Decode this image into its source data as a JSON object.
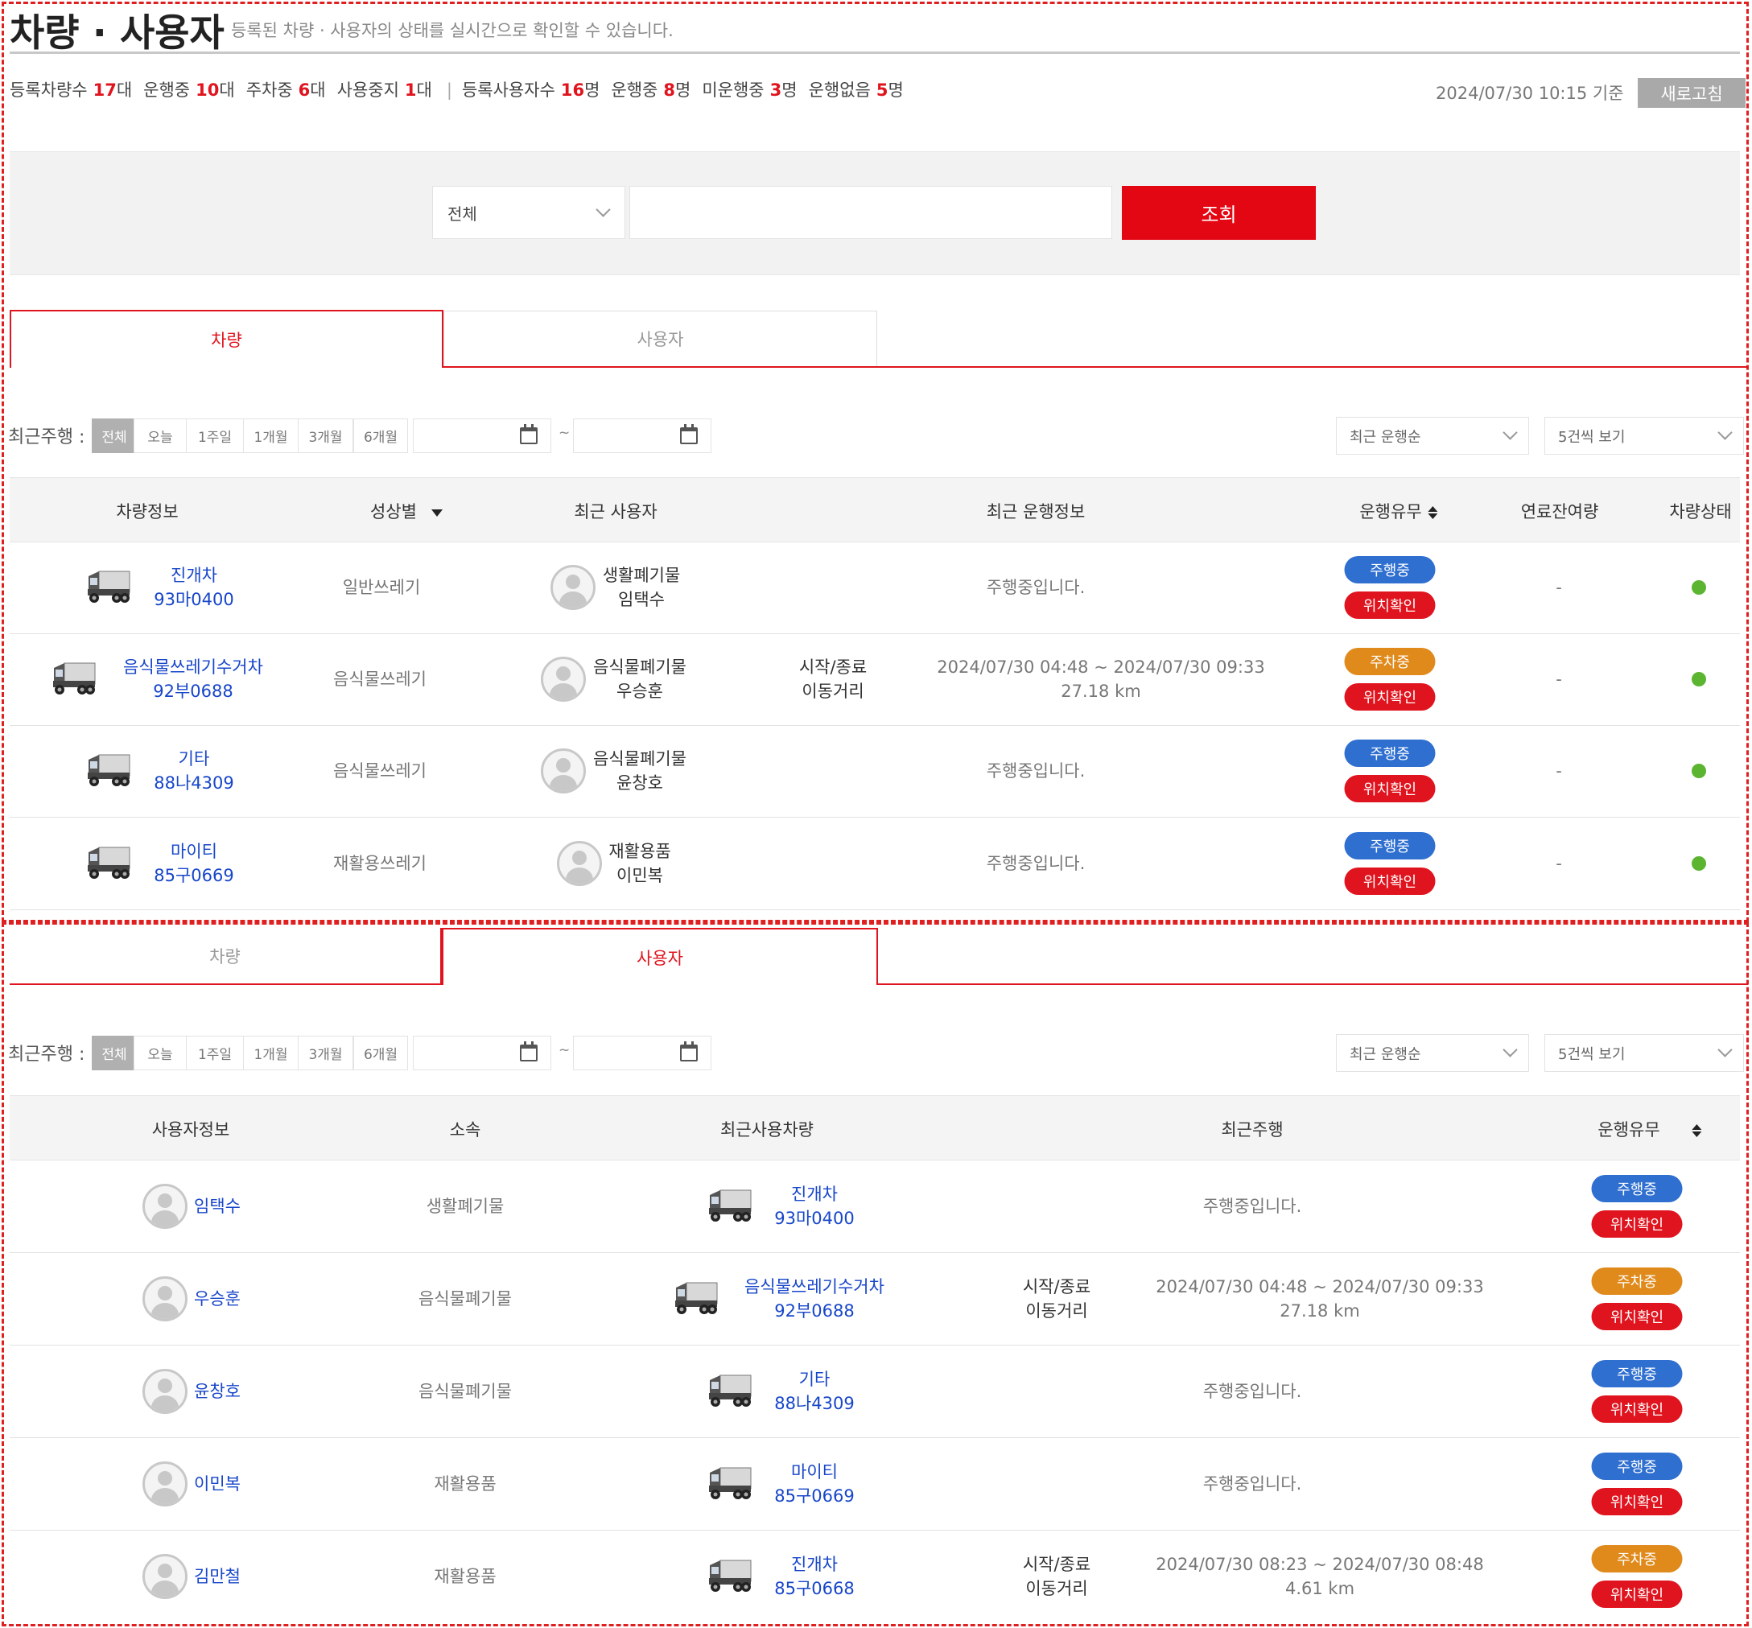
{
  "header": {
    "title": "차량 · 사용자",
    "description": "등록된 차량 · 사용자의 상태를 실시간으로 확인할 수 있습니다.",
    "as_of": "2024/07/30  10:15  기준",
    "refresh_label": "새로고침"
  },
  "stats": [
    {
      "label": "등록차량수",
      "value": "17",
      "unit": "대"
    },
    {
      "label": "운행중",
      "value": "10",
      "unit": "대"
    },
    {
      "label": "주차중",
      "value": "6",
      "unit": "대"
    },
    {
      "label": "사용중지",
      "value": "1",
      "unit": "대"
    },
    {
      "label": "등록사용자수",
      "value": "16",
      "unit": "명"
    },
    {
      "label": "운행중",
      "value": "8",
      "unit": "명"
    },
    {
      "label": "미운행중",
      "value": "3",
      "unit": "명"
    },
    {
      "label": "운행없음",
      "value": "5",
      "unit": "명"
    }
  ],
  "search": {
    "select_value": "전체",
    "input_value": "",
    "button_label": "조회"
  },
  "tabs": {
    "vehicle": "차량",
    "user": "사용자"
  },
  "filter": {
    "label": "최근주행 :",
    "chips": [
      "전체",
      "오늘",
      "1주일",
      "1개월",
      "3개월",
      "6개월"
    ],
    "active_chip": "전체",
    "tilde": "~",
    "sort_select": "최근 운행순",
    "page_size_select": "5건씩 보기"
  },
  "vehicle_table": {
    "headers": [
      "차량정보",
      "성상별",
      "최근 사용자",
      "최근 운행정보",
      "운행유무",
      "연료잔여량",
      "차량상태"
    ],
    "rows": [
      {
        "name": "진개차",
        "plate": "93마0400",
        "waste": "일반쓰레기",
        "user_org": "생활폐기물",
        "user_name": "임택수",
        "trip_label1": "",
        "trip_label2": "",
        "trip_line1": "주행중입니다.",
        "trip_line2": "",
        "status": "주행중",
        "status_type": "drive",
        "locate": "위치확인",
        "fuel": "-"
      },
      {
        "name": "음식물쓰레기수거차",
        "plate": "92부0688",
        "waste": "음식물쓰레기",
        "user_org": "음식물폐기물",
        "user_name": "우승훈",
        "trip_label1": "시작/종료",
        "trip_label2": "이동거리",
        "trip_line1": "2024/07/30 04:48 ~ 2024/07/30 09:33",
        "trip_line2": "27.18 km",
        "status": "주차중",
        "status_type": "park",
        "locate": "위치확인",
        "fuel": "-"
      },
      {
        "name": "기타",
        "plate": "88나4309",
        "waste": "음식물쓰레기",
        "user_org": "음식물폐기물",
        "user_name": "윤창호",
        "trip_label1": "",
        "trip_label2": "",
        "trip_line1": "주행중입니다.",
        "trip_line2": "",
        "status": "주행중",
        "status_type": "drive",
        "locate": "위치확인",
        "fuel": "-"
      },
      {
        "name": "마이티",
        "plate": "85구0669",
        "waste": "재활용쓰레기",
        "user_org": "재활용품",
        "user_name": "이민복",
        "trip_label1": "",
        "trip_label2": "",
        "trip_line1": "주행중입니다.",
        "trip_line2": "",
        "status": "주행중",
        "status_type": "drive",
        "locate": "위치확인",
        "fuel": "-"
      }
    ]
  },
  "user_table": {
    "headers": [
      "사용자정보",
      "소속",
      "최근사용차량",
      "최근주행",
      "운행유무"
    ],
    "rows": [
      {
        "name": "임택수",
        "org": "생활폐기물",
        "vehicle": "진개차",
        "plate": "93마0400",
        "trip_label1": "",
        "trip_label2": "",
        "trip_line1": "주행중입니다.",
        "trip_line2": "",
        "status": "주행중",
        "status_type": "drive",
        "locate": "위치확인"
      },
      {
        "name": "우승훈",
        "org": "음식물폐기물",
        "vehicle": "음식물쓰레기수거차",
        "plate": "92부0688",
        "trip_label1": "시작/종료",
        "trip_label2": "이동거리",
        "trip_line1": "2024/07/30 04:48 ~ 2024/07/30 09:33",
        "trip_line2": "27.18 km",
        "status": "주차중",
        "status_type": "park",
        "locate": "위치확인"
      },
      {
        "name": "윤창호",
        "org": "음식물폐기물",
        "vehicle": "기타",
        "plate": "88나4309",
        "trip_label1": "",
        "trip_label2": "",
        "trip_line1": "주행중입니다.",
        "trip_line2": "",
        "status": "주행중",
        "status_type": "drive",
        "locate": "위치확인"
      },
      {
        "name": "이민복",
        "org": "재활용품",
        "vehicle": "마이티",
        "plate": "85구0669",
        "trip_label1": "",
        "trip_label2": "",
        "trip_line1": "주행중입니다.",
        "trip_line2": "",
        "status": "주행중",
        "status_type": "drive",
        "locate": "위치확인"
      },
      {
        "name": "김만철",
        "org": "재활용품",
        "vehicle": "진개차",
        "plate": "85구0668",
        "trip_label1": "시작/종료",
        "trip_label2": "이동거리",
        "trip_line1": "2024/07/30 08:23 ~ 2024/07/30 08:48",
        "trip_line2": "4.61 km",
        "status": "주차중",
        "status_type": "park",
        "locate": "위치확인"
      }
    ]
  },
  "colors": {
    "accent": "#e0141e",
    "drive": "#2f6fd0",
    "park": "#e08a1c",
    "status_ok": "#5cb531",
    "link": "#1746c9"
  },
  "icons": [
    "truck-icon",
    "user-avatar-icon",
    "calendar-icon",
    "chevron-down-icon",
    "sort-icon",
    "status-dot-icon"
  ]
}
